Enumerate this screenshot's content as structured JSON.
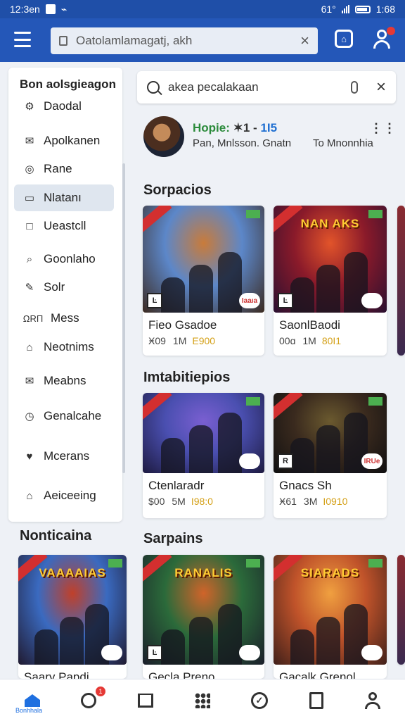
{
  "status_bar": {
    "time": "12:3en",
    "battery": "1:68",
    "signal": "61°"
  },
  "top_bar": {
    "search_text": "Oatolamlamagatj, akh",
    "clear_symbol": "×"
  },
  "sidebar": {
    "title": "Bon aolsgieagon",
    "items": [
      {
        "label": "Daodal",
        "icon": "settings-icon"
      },
      {
        "label": "Apolkanen",
        "icon": "mail-icon"
      },
      {
        "label": "Rane",
        "icon": "globe-icon"
      },
      {
        "label": "Nlatanı",
        "icon": "window-icon",
        "active": true
      },
      {
        "label": "Ueastcll",
        "icon": "square-icon"
      },
      {
        "label": "Goonlaho",
        "icon": "search-icon"
      },
      {
        "label": "Solr",
        "icon": "wrench-icon"
      },
      {
        "label": "Mess",
        "icon": "text-icon",
        "icon_text": "ΩRΠ"
      },
      {
        "label": "Neotnims",
        "icon": "building-icon"
      },
      {
        "label": "Meabns",
        "icon": "envelope-icon"
      },
      {
        "label": "Genalcahe",
        "icon": "clock-icon"
      },
      {
        "label": "Mcerans",
        "icon": "heart-icon"
      },
      {
        "label": "Aeiceeing",
        "icon": "home-icon"
      }
    ]
  },
  "search": {
    "text": "akea pecalakaan",
    "clear_symbol": "×"
  },
  "profile": {
    "name": "Hopie:",
    "name_mid": "✶1 -",
    "score": "1I5",
    "subtitle": "Pan, Mnlsson. Gnatn",
    "subtitle_right": "To Mnonnhia",
    "menu_symbol": "⋮⋮"
  },
  "sections": {
    "s1": {
      "title": "Sorpacios",
      "cards": [
        {
          "title": "Fieo Gsadoe",
          "meta_a": "Ӿ09",
          "meta_b": "1M",
          "meta_c": "E900",
          "banner": "",
          "badge": "Iaaıa",
          "tag": "Ŀ"
        },
        {
          "title": "SaonlBaodi",
          "meta_a": "00ɑ",
          "meta_b": "1M",
          "meta_c": "80I1",
          "banner": "NAN AKS",
          "badge": "",
          "tag": "Ŀ"
        }
      ]
    },
    "s2": {
      "title": "Imtabitiepios",
      "cards": [
        {
          "title": "Ctenlaradr",
          "meta_a": "$00",
          "meta_b": "5M",
          "meta_c": "I98:0",
          "banner": "",
          "badge": "",
          "tag": ""
        },
        {
          "title": "Gnacs Sh",
          "meta_a": "Ӿ61",
          "meta_b": "3M",
          "meta_c": "I0910",
          "banner": "",
          "badge": "IRUe",
          "tag": "R"
        }
      ]
    },
    "s3": {
      "title": "Sarpains",
      "cards": [
        {
          "title": "Gecla Preno",
          "banner": "RANALIS",
          "badge": "",
          "tag": "Ŀ"
        },
        {
          "title": "Gacalk Grenol",
          "banner": "SIARADS",
          "badge": "",
          "tag": ""
        }
      ]
    },
    "s4": {
      "title": "Nonticaina",
      "cards": [
        {
          "title": "Saary Papdi",
          "banner": "VAAAAIAS",
          "badge": "",
          "tag": ""
        }
      ]
    }
  },
  "bottom_nav": {
    "home_label": "Bonhhala",
    "badge_count": "1"
  },
  "colors": {
    "app_bar": "#2457b8",
    "accent": "#1e6fe0",
    "badge_red": "#e53935"
  }
}
